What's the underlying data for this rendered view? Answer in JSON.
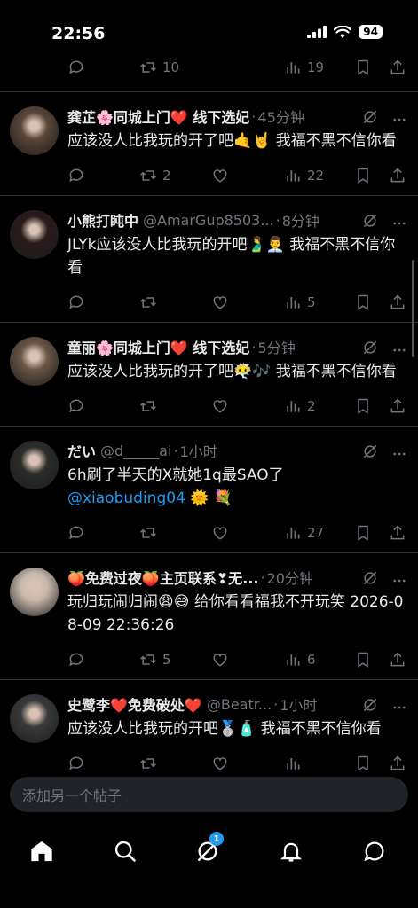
{
  "status_bar": {
    "time": "22:56",
    "battery": "94"
  },
  "partial_post": {
    "retweets": "10",
    "views": "19"
  },
  "posts": [
    {
      "name": "龚芷🌸同城上门❤️ 线下选妃",
      "handle": "",
      "time": "45分钟",
      "text": "应该没人比我玩的开了吧🤙🤘 我福不黑不信你看",
      "mention": "",
      "emoji_after_mention": "",
      "replies": "",
      "retweets": "2",
      "likes": "",
      "views": "22",
      "avatar_color": "#5a4638"
    },
    {
      "name": "小熊打盹中",
      "handle": "@AmarGup8503...",
      "time": "8分钟",
      "text": "JLYk应该没人比我玩的开吧🫃👨‍💼 我福不黑不信你看",
      "mention": "",
      "emoji_after_mention": "",
      "replies": "",
      "retweets": "",
      "likes": "",
      "views": "5",
      "avatar_color": "#2a1a1c"
    },
    {
      "name": "童丽🌸同城上门❤️ 线下选妃",
      "handle": "",
      "time": "5分钟",
      "text": "应该没人比我玩的开了吧😶‍🌫️🎶 我福不黑不信你看",
      "mention": "",
      "emoji_after_mention": "",
      "replies": "",
      "retweets": "",
      "likes": "",
      "views": "2",
      "avatar_color": "#6b5646"
    },
    {
      "name": "だい",
      "handle": "@d_____ai",
      "time": "1小时",
      "text": "6h刷了半天的X就她1q最SAO了",
      "mention": "@xiaobuding04",
      "emoji_after_mention": " 🌞 💐",
      "replies": "",
      "retweets": "",
      "likes": "",
      "views": "27",
      "avatar_color": "#2b2d2b"
    },
    {
      "name": "🍑免费过夜🍑主页联系❣无...",
      "handle": "",
      "time": "20分钟",
      "text": "玩归玩闹归闹😩😅 给你看看福我不开玩笑 2026-08-09 22:36:26",
      "mention": "",
      "emoji_after_mention": "",
      "replies": "",
      "retweets": "5",
      "likes": "",
      "views": "6",
      "avatar_color": "#c9b9ac"
    },
    {
      "name": "史鹭李❤️免费破处❤️",
      "handle": "@Beatr...",
      "time": "1小时",
      "text": "应该没人比我玩的开吧🥈🧴 我福不黑不信你看",
      "mention": "",
      "emoji_after_mention": "",
      "replies": "",
      "retweets": "",
      "likes": "",
      "views": "",
      "avatar_color": "#3a3a3c"
    }
  ],
  "compose": {
    "placeholder": "添加另一个帖子"
  },
  "tabbar": {
    "notifications_badge": "1"
  },
  "colors": {
    "accent": "#1d9bf0",
    "muted": "#71767b",
    "divider": "#2f3336"
  }
}
